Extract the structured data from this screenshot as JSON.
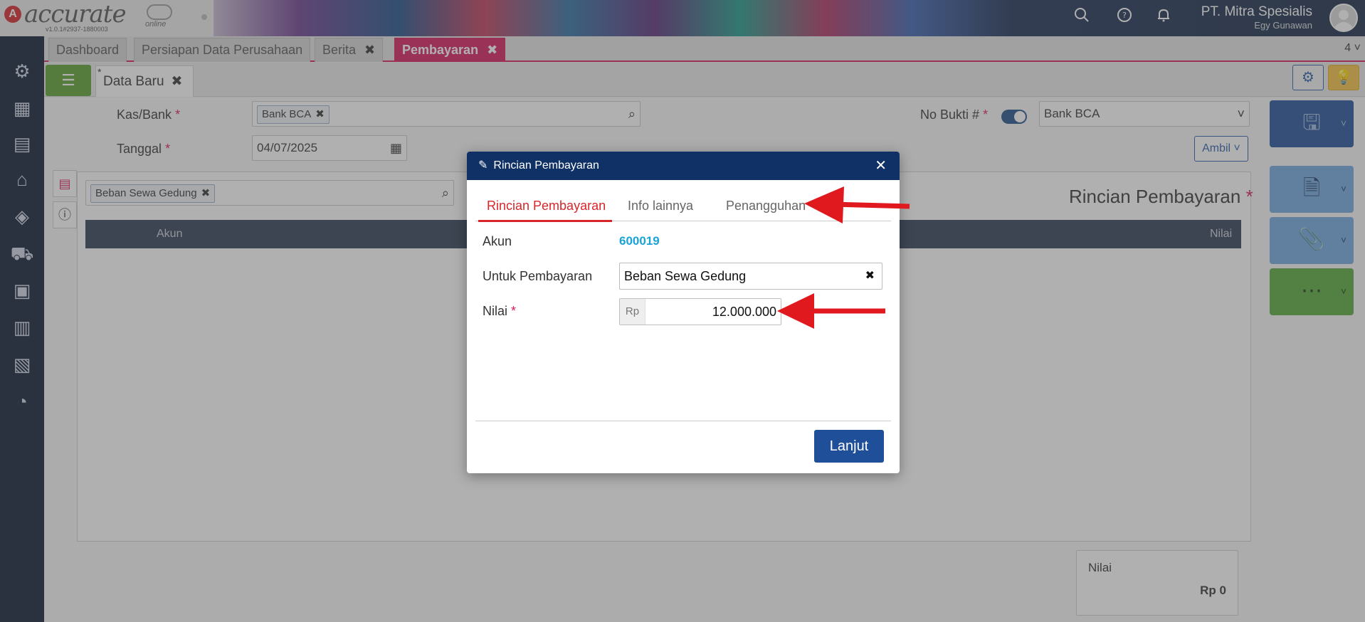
{
  "header": {
    "logo_text": "accurate",
    "logo_sub": "online",
    "version": "v1.0.1#2937-1880003",
    "company": "PT. Mitra Spesialis",
    "user": "Egy Gunawan",
    "icons": [
      "search-icon",
      "help-icon",
      "bell-icon"
    ]
  },
  "sidebar": {
    "icons": [
      "settings-icon",
      "company-icon",
      "ledger-icon",
      "bank-icon",
      "money-bag-icon",
      "cart-icon",
      "sales-icon",
      "inventory-icon",
      "tax-icon",
      "report-icon"
    ]
  },
  "tabs": [
    {
      "label": "Dashboard",
      "closable": false
    },
    {
      "label": "Persiapan Data Perusahaan",
      "closable": false
    },
    {
      "label": "Berita",
      "closable": true
    },
    {
      "label": "Pembayaran",
      "closable": true,
      "active": true
    }
  ],
  "tab_count": "4",
  "subtab": {
    "star": "*",
    "label": "Data Baru"
  },
  "form": {
    "kas_label": "Kas/Bank",
    "kas_value": "Bank BCA",
    "tanggal_label": "Tanggal",
    "tanggal_value": "04/07/2025",
    "nobukti_label": "No Bukti #",
    "nobukti_value": "Bank BCA",
    "ambil_label": "Ambil",
    "detail_search_chip": "Beban Sewa Gedung",
    "table_headers": [
      "Akun",
      "Nilai"
    ],
    "rincian_title": "Rincian Pembayaran",
    "nilai_label": "Nilai",
    "nilai_value": "Rp 0"
  },
  "modal": {
    "title": "Rincian Pembayaran",
    "tabs": [
      "Rincian Pembayaran",
      "Info lainnya",
      "Penangguhan"
    ],
    "akun_label": "Akun",
    "akun_value": "600019",
    "untuk_label": "Untuk Pembayaran",
    "untuk_value": "Beban Sewa Gedung",
    "nilai_label": "Nilai",
    "nilai_prefix": "Rp",
    "nilai_value": "12.000.000",
    "lanjut_label": "Lanjut"
  },
  "colors": {
    "accent": "#d81b60",
    "modal_header": "#0f3166",
    "active_tab_text": "#d6262b",
    "link": "#1aa3d6",
    "arrow": "#e0191f"
  }
}
